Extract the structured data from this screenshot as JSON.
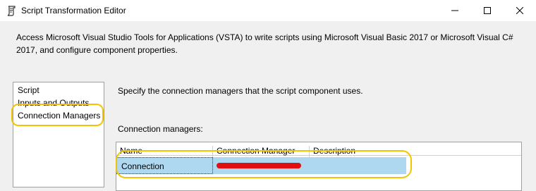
{
  "window": {
    "title": "Script Transformation Editor",
    "icons": {
      "app": "script-icon",
      "minimize": "minimize-icon",
      "maximize": "maximize-icon",
      "close": "close-icon"
    }
  },
  "description": "Access Microsoft Visual Studio Tools for Applications (VSTA) to write scripts using Microsoft Visual Basic 2017 or Microsoft Visual C# 2017, and configure component properties.",
  "nav": {
    "items": [
      {
        "label": "Script"
      },
      {
        "label": "Inputs and Outputs"
      },
      {
        "label": "Connection Managers"
      }
    ],
    "selected": "Connection Managers"
  },
  "main": {
    "instruction": "Specify the connection managers that the script component uses.",
    "connection_managers_label": "Connection managers:",
    "columns": [
      "Name",
      "Connection Manager",
      "Description"
    ],
    "rows": [
      {
        "name": "Connection",
        "connection_manager": "",
        "description": ""
      }
    ]
  },
  "colors": {
    "highlight": "#f5c400",
    "selected_row": "#add8f0",
    "redaction": "#e01010"
  }
}
